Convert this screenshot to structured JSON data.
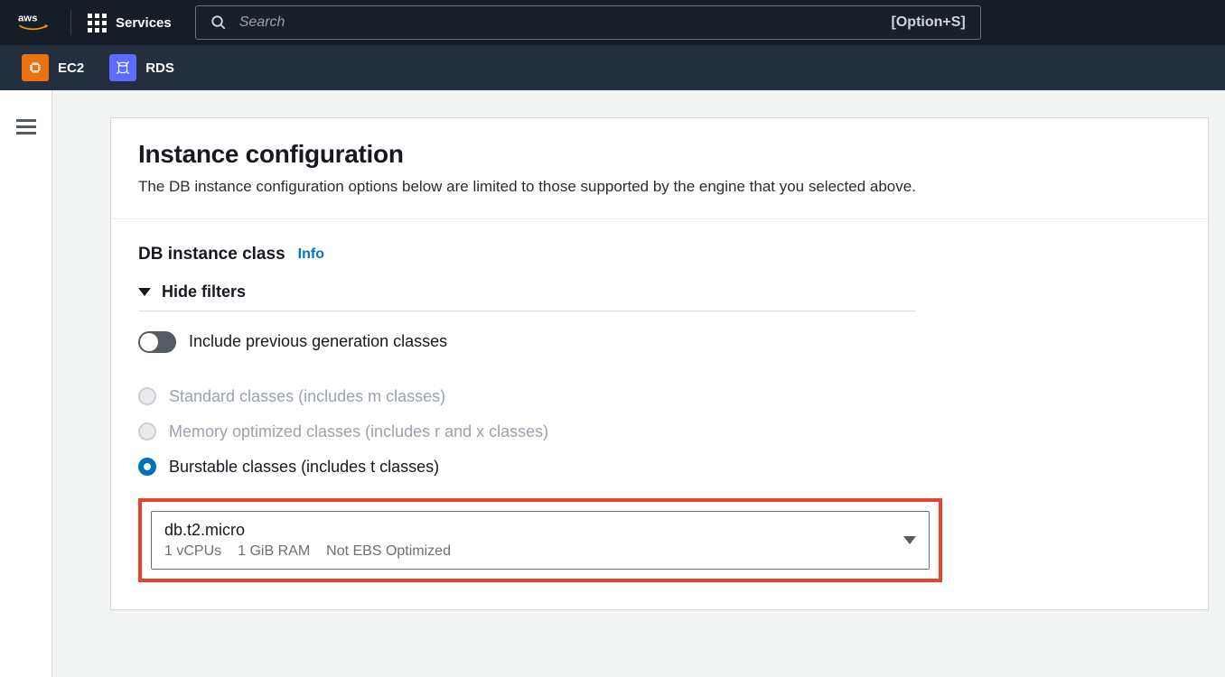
{
  "nav": {
    "services_label": "Services",
    "search_placeholder": "Search",
    "kbd_hint": "[Option+S]",
    "shortcuts": {
      "ec2": "EC2",
      "rds": "RDS"
    }
  },
  "panel": {
    "title": "Instance configuration",
    "description": "The DB instance configuration options below are limited to those supported by the engine that you selected above."
  },
  "field": {
    "label": "DB instance class",
    "info_link": "Info"
  },
  "filters": {
    "toggle_label": "Hide filters",
    "include_prev_label": "Include previous generation classes"
  },
  "radios": {
    "standard": "Standard classes (includes m classes)",
    "memory": "Memory optimized classes (includes r and x classes)",
    "burstable": "Burstable classes (includes t classes)"
  },
  "instance_select": {
    "value": "db.t2.micro",
    "vcpus": "1 vCPUs",
    "ram": "1 GiB RAM",
    "ebs": "Not EBS Optimized"
  }
}
